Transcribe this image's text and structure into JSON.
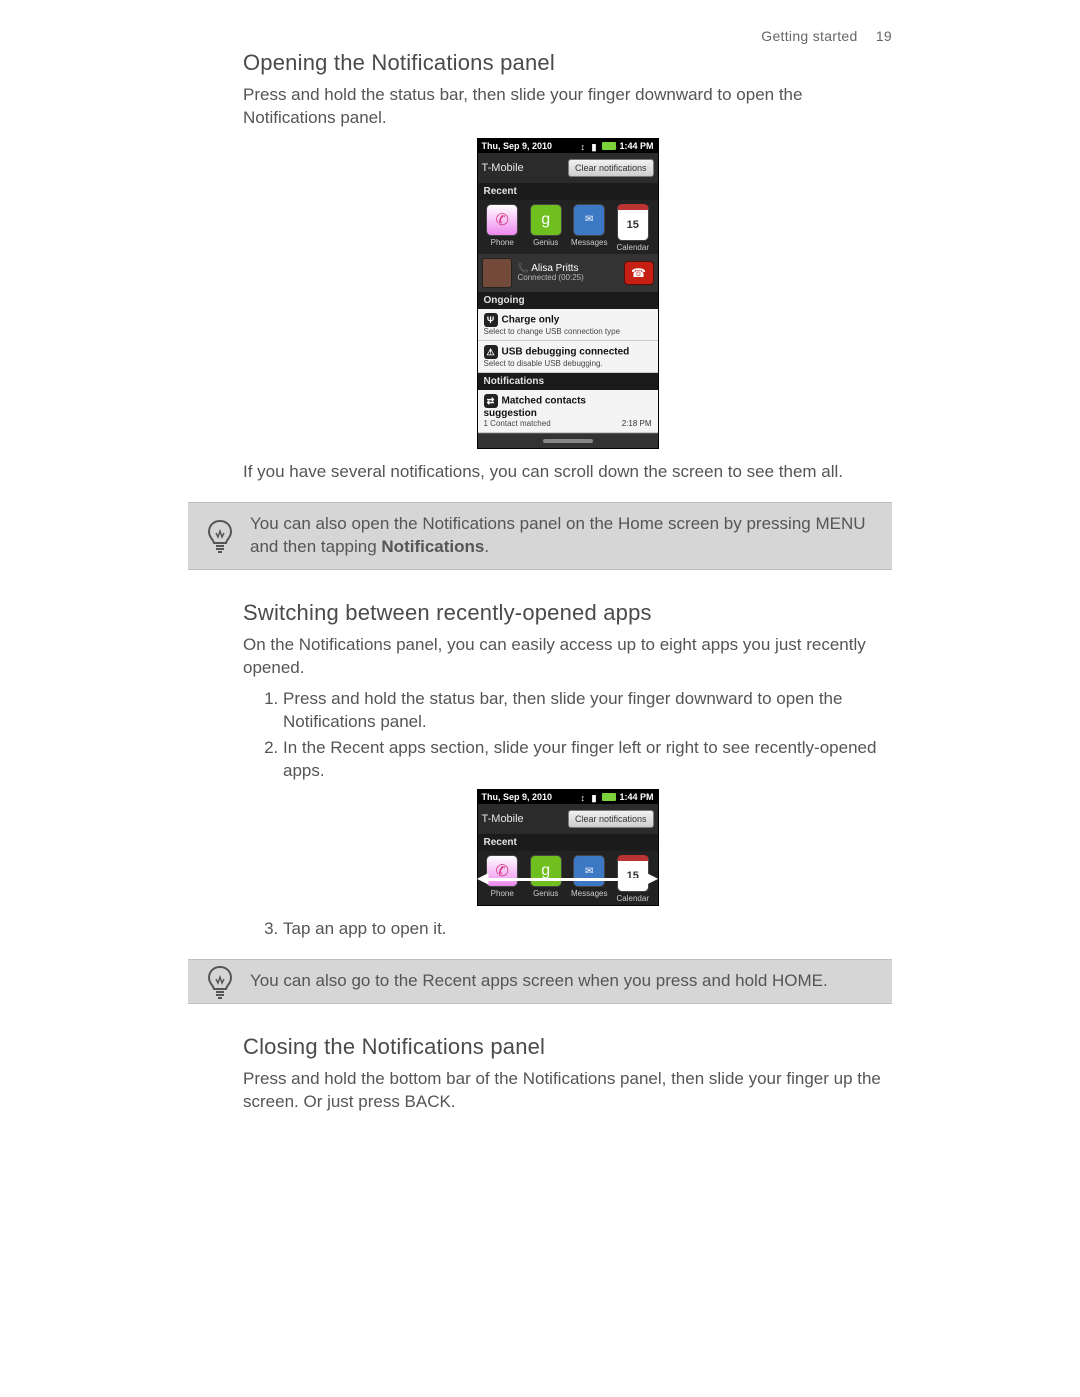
{
  "header": {
    "section": "Getting started",
    "page_number": "19"
  },
  "s1": {
    "title": "Opening the Notifications panel",
    "para1": "Press and hold the status bar, then slide your finger downward to open the Notifications panel.",
    "para2": "If you have several notifications, you can scroll down the screen to see them all.",
    "tip_a": "You can also open the Notifications panel on the Home screen by pressing MENU and then tapping ",
    "tip_b": "Notifications",
    "tip_c": "."
  },
  "phone1": {
    "date": "Thu, Sep 9, 2010",
    "time": "1:44 PM",
    "carrier": "T-Mobile",
    "clear": "Clear notifications",
    "sec_recent": "Recent",
    "apps": [
      "Phone",
      "Genius",
      "Messages",
      "Calendar"
    ],
    "call_name": "Alisa Pritts",
    "call_sub": "Connected (00:25)",
    "sec_ongoing": "Ongoing",
    "n1_t": "Charge only",
    "n1_s": "Select to change USB connection type",
    "n2_t": "USB debugging connected",
    "n2_s": "Select to disable USB debugging.",
    "sec_notif": "Notifications",
    "n3_t": "Matched contacts suggestion",
    "n3_s": "1 Contact matched",
    "n3_time": "2:18 PM",
    "cal_day": "15"
  },
  "s2": {
    "title": "Switching between recently-opened apps",
    "para1": "On the Notifications panel, you can easily access up to eight apps you just recently opened.",
    "li1": "Press and hold the status bar, then slide your finger downward to open the Notifications panel.",
    "li2": "In the Recent apps section, slide your finger left or right to see recently-opened apps.",
    "li3": "Tap an app to open it.",
    "tip": "You can also go to the Recent apps screen when you press and hold HOME."
  },
  "phone2": {
    "date": "Thu, Sep 9, 2010",
    "time": "1:44 PM",
    "carrier": "T-Mobile",
    "clear": "Clear notifications",
    "sec_recent": "Recent",
    "apps": [
      "Phone",
      "Genius",
      "Messages",
      "Calendar"
    ]
  },
  "s3": {
    "title": "Closing the Notifications panel",
    "para1": "Press and hold the bottom bar of the Notifications panel, then slide your finger up the screen. Or just press BACK."
  }
}
